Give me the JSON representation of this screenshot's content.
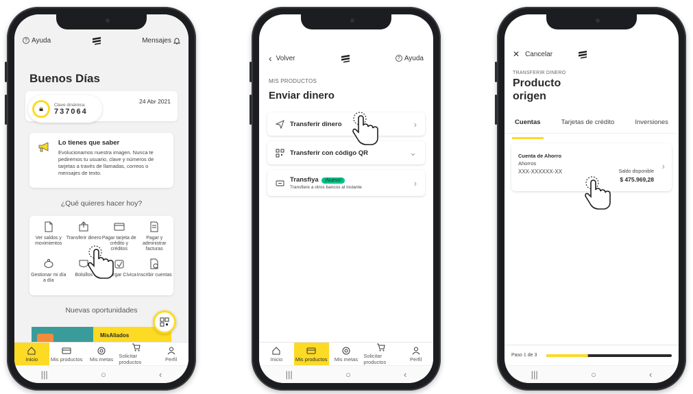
{
  "phone1": {
    "help_label": "Ayuda",
    "messages_label": "Mensajes",
    "greeting": "Buenos Días",
    "dynamic_key_label": "Clave dinámica",
    "dynamic_key_value": "737064",
    "date": "24 Abr 2021",
    "notice_title": "Lo tienes que saber",
    "notice_body": "Evolucionamos nuestra imagen. Nunca te pediremos tu usuario, clave y números de tarjetas a través de llamadas, correos o mensajes de texto.",
    "question": "¿Qué quieres hacer hoy?",
    "actions": [
      {
        "label": "Ver saldos y movimientos",
        "icon": "document-icon"
      },
      {
        "label": "Transferir dinero",
        "icon": "transfer-icon"
      },
      {
        "label": "Pagar tarjeta de crédito y créditos",
        "icon": "card-icon"
      },
      {
        "label": "Pagar y administrar facturas",
        "icon": "invoice-icon"
      },
      {
        "label": "Gestionar mi día a día",
        "icon": "piggy-icon"
      },
      {
        "label": "Bolsillos",
        "icon": "pocket-icon"
      },
      {
        "label": "Recargar Cívica",
        "icon": "recharge-icon"
      },
      {
        "label": "Inscribir cuentas",
        "icon": "add-account-icon"
      }
    ],
    "opportunities_title": "Nuevas oportunidades",
    "promo_label": "MisAliados",
    "active_tab": 0
  },
  "tabbar": [
    {
      "label": "Inicio",
      "icon": "home-icon"
    },
    {
      "label": "Mis productos",
      "icon": "wallet-icon"
    },
    {
      "label": "Mis metas",
      "icon": "target-icon"
    },
    {
      "label": "Solicitar productos",
      "icon": "cart-icon"
    },
    {
      "label": "Perfil",
      "icon": "user-icon"
    }
  ],
  "phone2": {
    "back_label": "Volver",
    "help_label": "Ayuda",
    "section_caption": "MIS PRODUCTOS",
    "title": "Enviar dinero",
    "options": [
      {
        "label": "Transferir dinero",
        "icon": "plane-icon",
        "chevron": "›"
      },
      {
        "label": "Transferir con código QR",
        "icon": "qr-icon",
        "chevron": "⌄"
      },
      {
        "label": "Transfiya",
        "badge": "¡Nuevo!",
        "sub": "Transfiere a otros bancos al instante",
        "icon": "phone-transfer-icon",
        "chevron": "›"
      }
    ],
    "active_tab": 1
  },
  "phone3": {
    "cancel_label": "Cancelar",
    "caption": "TRANSFERIR DINERO",
    "title_line1": "Producto",
    "title_line2": "origen",
    "tabs": [
      "Cuentas",
      "Tarjetas de crédito",
      "Inversiones"
    ],
    "account_name": "Cuenta de Ahorro",
    "account_type": "Ahorros",
    "account_number": "XXX-XXXXXX-XX",
    "balance_label": "Saldo disponible",
    "balance_value": "$ 475.969,28",
    "step_label": "Paso 1 de 3",
    "step_progress": 0.33
  },
  "sysnav": {
    "recents": "|||",
    "home": "○",
    "back": "‹"
  }
}
